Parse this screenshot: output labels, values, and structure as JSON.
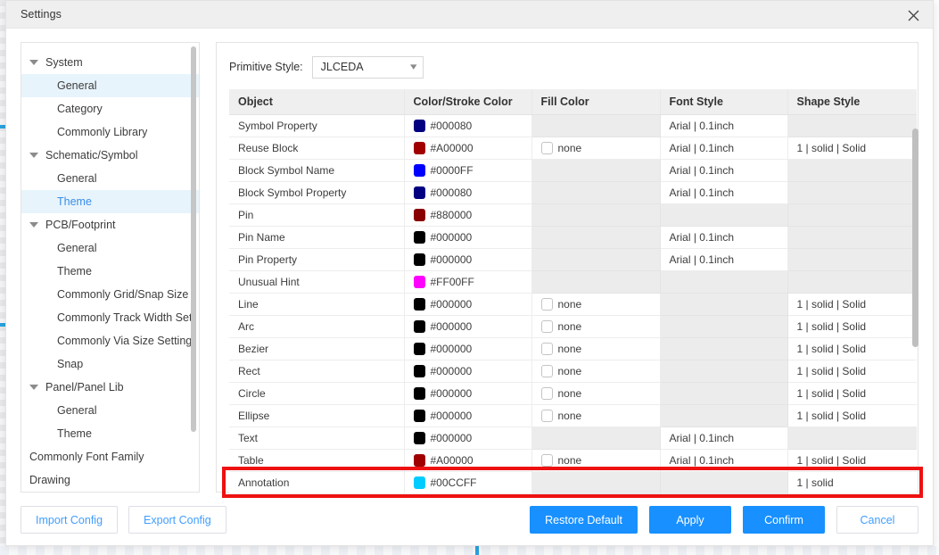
{
  "window": {
    "title": "Settings",
    "close_icon": "close-icon"
  },
  "sidebar": {
    "items": [
      {
        "label": "System",
        "level": 0,
        "caret": true,
        "selected": false
      },
      {
        "label": "General",
        "level": 1,
        "caret": false,
        "selected": true
      },
      {
        "label": "Category",
        "level": 1,
        "caret": false,
        "selected": false
      },
      {
        "label": "Commonly Library",
        "level": 1,
        "caret": false,
        "selected": false
      },
      {
        "label": "Schematic/Symbol",
        "level": 0,
        "caret": true,
        "selected": false
      },
      {
        "label": "General",
        "level": 1,
        "caret": false,
        "selected": false
      },
      {
        "label": "Theme",
        "level": 1,
        "caret": false,
        "selected": true,
        "active": true
      },
      {
        "label": "PCB/Footprint",
        "level": 0,
        "caret": true,
        "selected": false
      },
      {
        "label": "General",
        "level": 1,
        "caret": false,
        "selected": false
      },
      {
        "label": "Theme",
        "level": 1,
        "caret": false,
        "selected": false
      },
      {
        "label": "Commonly Grid/Snap Size S",
        "level": 1,
        "caret": false,
        "selected": false
      },
      {
        "label": "Commonly Track Width Sett",
        "level": 1,
        "caret": false,
        "selected": false
      },
      {
        "label": "Commonly Via Size Setting",
        "level": 1,
        "caret": false,
        "selected": false
      },
      {
        "label": "Snap",
        "level": 1,
        "caret": false,
        "selected": false
      },
      {
        "label": "Panel/Panel Lib",
        "level": 0,
        "caret": true,
        "selected": false
      },
      {
        "label": "General",
        "level": 1,
        "caret": false,
        "selected": false
      },
      {
        "label": "Theme",
        "level": 1,
        "caret": false,
        "selected": false
      },
      {
        "label": "Commonly Font Family",
        "level": 0,
        "caret": false,
        "selected": false
      },
      {
        "label": "Drawing",
        "level": 0,
        "caret": false,
        "selected": false
      }
    ]
  },
  "content": {
    "primitive_style_label": "Primitive Style:",
    "primitive_style_value": "JLCEDA",
    "chevron_icon": "chevron-down-icon"
  },
  "table": {
    "columns": [
      "Object",
      "Color/Stroke Color",
      "Fill Color",
      "Font Style",
      "Shape Style"
    ],
    "rows": [
      {
        "object": "Symbol Property",
        "color": "#000080",
        "color_label": "#000080",
        "fill": "",
        "font": "Arial | 0.1inch",
        "shape": ""
      },
      {
        "object": "Reuse Block",
        "color": "#A00000",
        "color_label": "#A00000",
        "fill": "none",
        "font": "Arial | 0.1inch",
        "shape": "1 | solid | Solid"
      },
      {
        "object": "Block Symbol Name",
        "color": "#0000FF",
        "color_label": "#0000FF",
        "fill": "",
        "font": "Arial | 0.1inch",
        "shape": ""
      },
      {
        "object": "Block Symbol Property",
        "color": "#000080",
        "color_label": "#000080",
        "fill": "",
        "font": "Arial | 0.1inch",
        "shape": ""
      },
      {
        "object": "Pin",
        "color": "#880000",
        "color_label": "#880000",
        "fill": "",
        "font": "",
        "shape": ""
      },
      {
        "object": "Pin Name",
        "color": "#000000",
        "color_label": "#000000",
        "fill": "",
        "font": "Arial | 0.1inch",
        "shape": ""
      },
      {
        "object": "Pin Property",
        "color": "#000000",
        "color_label": "#000000",
        "fill": "",
        "font": "Arial | 0.1inch",
        "shape": ""
      },
      {
        "object": "Unusual Hint",
        "color": "#FF00FF",
        "color_label": "#FF00FF",
        "fill": "",
        "font": "",
        "shape": ""
      },
      {
        "object": "Line",
        "color": "#000000",
        "color_label": "#000000",
        "fill": "none",
        "font": "",
        "shape": "1 | solid | Solid"
      },
      {
        "object": "Arc",
        "color": "#000000",
        "color_label": "#000000",
        "fill": "none",
        "font": "",
        "shape": "1 | solid | Solid"
      },
      {
        "object": "Bezier",
        "color": "#000000",
        "color_label": "#000000",
        "fill": "none",
        "font": "",
        "shape": "1 | solid | Solid"
      },
      {
        "object": "Rect",
        "color": "#000000",
        "color_label": "#000000",
        "fill": "none",
        "font": "",
        "shape": "1 | solid | Solid"
      },
      {
        "object": "Circle",
        "color": "#000000",
        "color_label": "#000000",
        "fill": "none",
        "font": "",
        "shape": "1 | solid | Solid"
      },
      {
        "object": "Ellipse",
        "color": "#000000",
        "color_label": "#000000",
        "fill": "none",
        "font": "",
        "shape": "1 | solid | Solid"
      },
      {
        "object": "Text",
        "color": "#000000",
        "color_label": "#000000",
        "fill": "",
        "font": "Arial | 0.1inch",
        "shape": ""
      },
      {
        "object": "Table",
        "color": "#A00000",
        "color_label": "#A00000",
        "fill": "none",
        "font": "Arial | 0.1inch",
        "shape": "1 | solid | Solid"
      },
      {
        "object": "Annotation",
        "color": "#00CCFF",
        "color_label": "#00CCFF",
        "fill": "",
        "font": "",
        "shape": "1 | solid",
        "highlighted": true
      }
    ]
  },
  "footer": {
    "import_config": "Import Config",
    "export_config": "Export Config",
    "restore_default": "Restore Default",
    "apply": "Apply",
    "confirm": "Confirm",
    "cancel": "Cancel"
  },
  "colors": {
    "accent": "#1890ff",
    "link": "#409eff",
    "highlight_box": "#ee1111",
    "selected_row": "#e8f4fc"
  }
}
